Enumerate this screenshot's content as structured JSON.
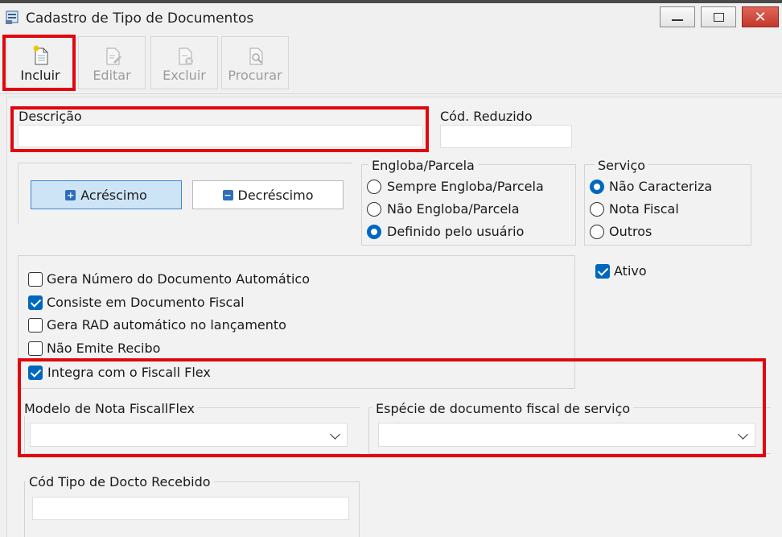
{
  "window": {
    "title": "Cadastro de Tipo de Documentos"
  },
  "toolbar": {
    "incluir": "Incluir",
    "editar": "Editar",
    "excluir": "Excluir",
    "procurar": "Procurar"
  },
  "form": {
    "descricao_label": "Descrição",
    "descricao_value": "",
    "cod_reduzido_label": "Cód. Reduzido",
    "cod_reduzido_value": "",
    "acrescimo_label": "Acréscimo",
    "decrescimo_label": "Decréscimo",
    "engloba": {
      "title": "Engloba/Parcela",
      "options": [
        "Sempre Engloba/Parcela",
        "Não Engloba/Parcela",
        "Definido pelo usuário"
      ],
      "selected": "Definido pelo usuário"
    },
    "servico": {
      "title": "Serviço",
      "options": [
        "Não Caracteriza",
        "Nota Fiscal",
        "Outros"
      ],
      "selected": "Não Caracteriza"
    },
    "ativo": {
      "label": "Ativo",
      "checked": true
    },
    "checks": [
      {
        "label": "Gera Número do Documento Automático",
        "checked": false
      },
      {
        "label": "Consiste em Documento Fiscal",
        "checked": true
      },
      {
        "label": "Gera RAD automático no lançamento",
        "checked": false
      },
      {
        "label": "Não Emite Recibo",
        "checked": false
      },
      {
        "label": "Integra com o Fiscall Flex",
        "checked": true
      }
    ],
    "modelo_label": "Modelo de Nota FiscallFlex",
    "modelo_value": "",
    "especie_label": "Espécie de documento fiscal de serviço",
    "especie_value": "",
    "cod_tipo_label": "Cód Tipo de Docto Recebido",
    "cod_tipo_value": ""
  },
  "colors": {
    "highlight": "#e0070e",
    "accent": "#0067c0",
    "active_button": "#cde4f7"
  },
  "icons": {
    "app": "form-icon",
    "incluir": "new-document-icon",
    "editar": "edit-document-icon",
    "excluir": "delete-document-icon",
    "procurar": "search-document-icon"
  }
}
